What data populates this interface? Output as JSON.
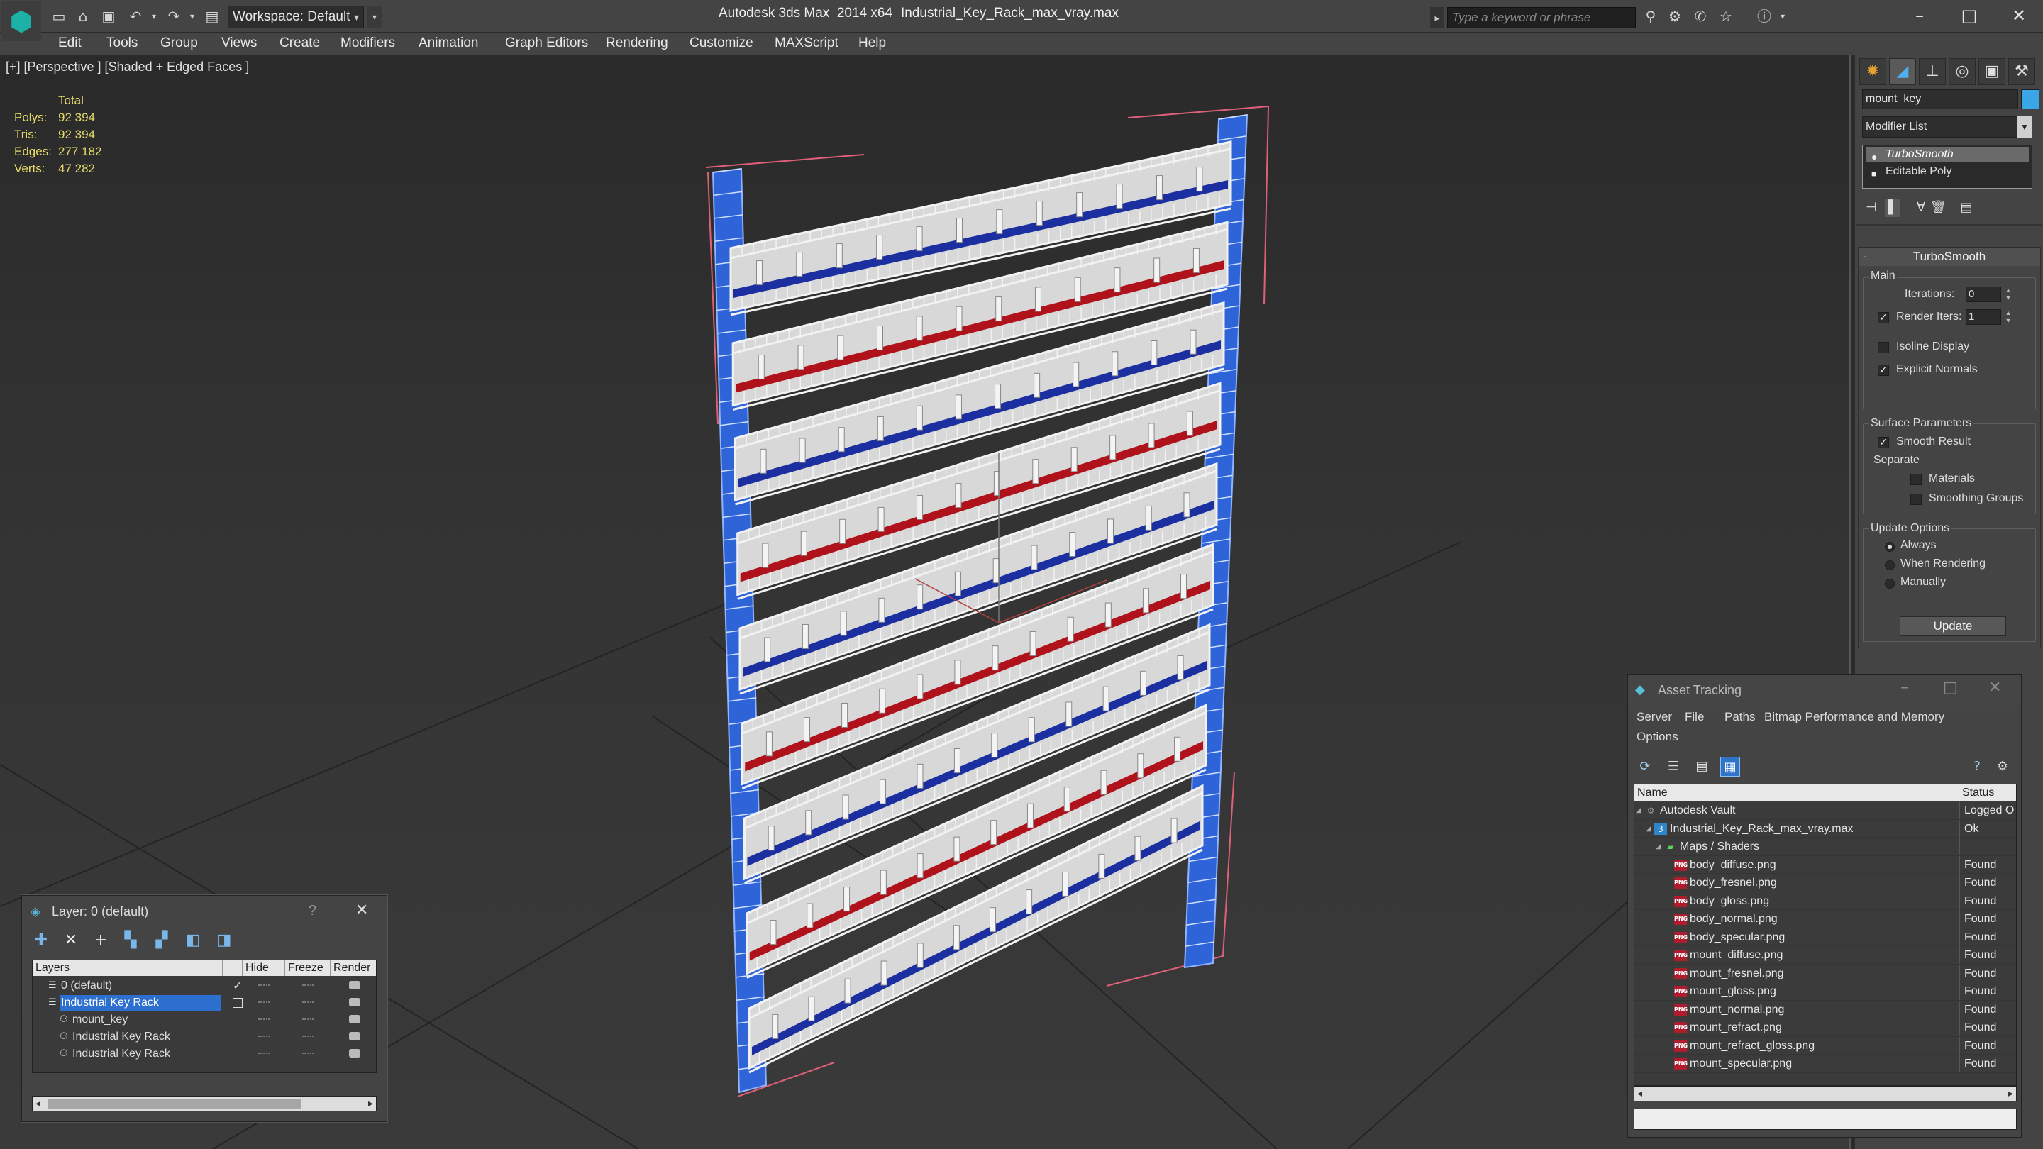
{
  "titlebar": {
    "workspace_label": "Workspace: Default",
    "app_title": "Autodesk 3ds Max  2014 x64",
    "doc_title": "Industrial_Key_Rack_max_vray.max",
    "search_placeholder": "Type a keyword or phrase"
  },
  "menu": [
    "Edit",
    "Tools",
    "Group",
    "Views",
    "Create",
    "Modifiers",
    "Animation",
    "Graph Editors",
    "Rendering",
    "Customize",
    "MAXScript",
    "Help"
  ],
  "viewport": {
    "label": "[+] [Perspective ] [Shaded + Edged Faces ]",
    "stats": {
      "header": "Total",
      "rows": [
        {
          "key": "Polys:",
          "value": "92 394"
        },
        {
          "key": "Tris:",
          "value": "92 394"
        },
        {
          "key": "Edges:",
          "value": "277 182"
        },
        {
          "key": "Verts:",
          "value": "47 282"
        }
      ]
    },
    "rack": {
      "tray_colors": [
        "#1b2fa0",
        "#b0121c",
        "#1b2fa0",
        "#b0121c",
        "#1b2fa0",
        "#b0121c",
        "#1b2fa0",
        "#b0121c",
        "#1b2fa0"
      ],
      "frame_color": "#2f63d8",
      "wire_color": "#f2f2f2",
      "bbox_color": "#e0607a"
    }
  },
  "command_panel": {
    "object_name": "mount_key",
    "object_color": "#3aa6e8",
    "modifier_list_label": "Modifier List",
    "stack": [
      "TurboSmooth",
      "Editable Poly"
    ],
    "turbosmooth": {
      "title": "TurboSmooth",
      "main_label": "Main",
      "iterations_label": "Iterations:",
      "iterations_value": "0",
      "render_iters_label": "Render Iters:",
      "render_iters_value": "1",
      "render_iters_checked": true,
      "isoline_label": "Isoline Display",
      "isoline_checked": false,
      "explicit_normals_label": "Explicit Normals",
      "explicit_normals_checked": true,
      "surface_params_label": "Surface Parameters",
      "smooth_result_label": "Smooth Result",
      "smooth_result_checked": true,
      "separate_label": "Separate",
      "materials_label": "Materials",
      "smoothing_groups_label": "Smoothing Groups",
      "update_options_label": "Update Options",
      "always_label": "Always",
      "when_rendering_label": "When Rendering",
      "manually_label": "Manually",
      "update_button": "Update"
    }
  },
  "layer_window": {
    "title": "Layer: 0 (default)",
    "help": "?",
    "columns": [
      "Layers",
      "Hide",
      "Freeze",
      "Render"
    ],
    "rows": [
      {
        "name": "0 (default)",
        "indent": 0,
        "selected": false,
        "active": true
      },
      {
        "name": "Industrial Key Rack",
        "indent": 0,
        "selected": true,
        "active": false
      },
      {
        "name": "mount_key",
        "indent": 1,
        "selected": false,
        "active": false
      },
      {
        "name": "Industrial Key Rack",
        "indent": 1,
        "selected": false,
        "active": false
      },
      {
        "name": "Industrial Key Rack",
        "indent": 1,
        "selected": false,
        "active": false
      }
    ]
  },
  "asset_tracking": {
    "title": "Asset Tracking",
    "menu": [
      "Server",
      "File",
      "Paths",
      "Bitmap Performance and Memory",
      "Options"
    ],
    "columns": [
      "Name",
      "Status"
    ],
    "rows": [
      {
        "name": "Autodesk Vault",
        "status": "Logged O",
        "indent": 0,
        "type": "vault"
      },
      {
        "name": "Industrial_Key_Rack_max_vray.max",
        "status": "Ok",
        "indent": 1,
        "type": "max"
      },
      {
        "name": "Maps / Shaders",
        "status": "",
        "indent": 2,
        "type": "folder"
      },
      {
        "name": "body_diffuse.png",
        "status": "Found",
        "indent": 3,
        "type": "png"
      },
      {
        "name": "body_fresnel.png",
        "status": "Found",
        "indent": 3,
        "type": "png"
      },
      {
        "name": "body_gloss.png",
        "status": "Found",
        "indent": 3,
        "type": "png"
      },
      {
        "name": "body_normal.png",
        "status": "Found",
        "indent": 3,
        "type": "png"
      },
      {
        "name": "body_specular.png",
        "status": "Found",
        "indent": 3,
        "type": "png"
      },
      {
        "name": "mount_diffuse.png",
        "status": "Found",
        "indent": 3,
        "type": "png"
      },
      {
        "name": "mount_fresnel.png",
        "status": "Found",
        "indent": 3,
        "type": "png"
      },
      {
        "name": "mount_gloss.png",
        "status": "Found",
        "indent": 3,
        "type": "png"
      },
      {
        "name": "mount_normal.png",
        "status": "Found",
        "indent": 3,
        "type": "png"
      },
      {
        "name": "mount_refract.png",
        "status": "Found",
        "indent": 3,
        "type": "png"
      },
      {
        "name": "mount_refract_gloss.png",
        "status": "Found",
        "indent": 3,
        "type": "png"
      },
      {
        "name": "mount_specular.png",
        "status": "Found",
        "indent": 3,
        "type": "png"
      }
    ]
  }
}
